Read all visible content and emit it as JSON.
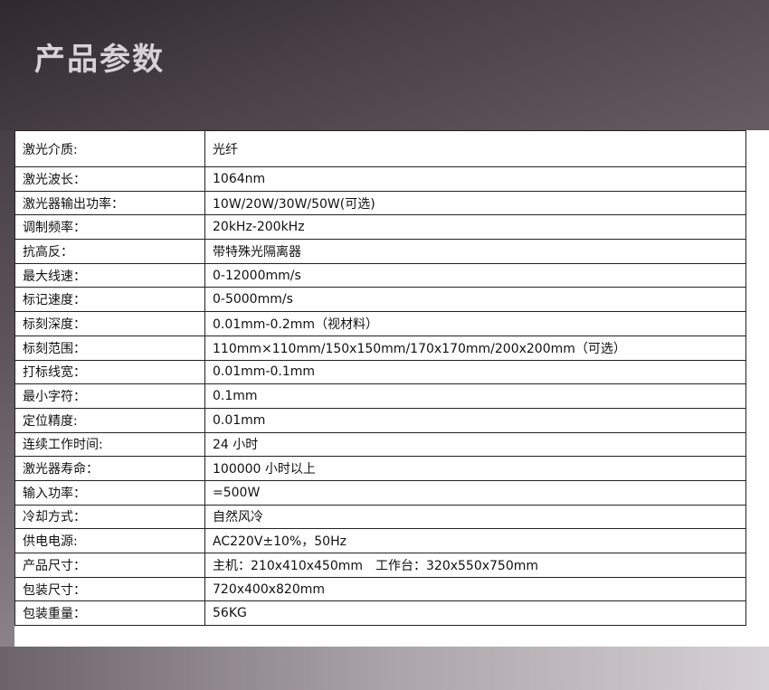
{
  "header": {
    "title": "产品参数"
  },
  "spec_rows": [
    {
      "label": "激光介质:",
      "value": "光纤"
    },
    {
      "label": "激光波长：",
      "value": "1064nm"
    },
    {
      "label": "激光器输出功率：",
      "value": "10W/20W/30W/50W(可选)"
    },
    {
      "label": "调制频率：",
      "value": "20kHz-200kHz"
    },
    {
      "label": "抗高反：",
      "value": "带特殊光隔离器"
    },
    {
      "label": "最大线速：",
      "value": "0-12000mm/s"
    },
    {
      "label": "标记速度：",
      "value": "0-5000mm/s"
    },
    {
      "label": "标刻深度：",
      "value": "0.01mm-0.2mm（视材料）"
    },
    {
      "label": "标刻范围：",
      "value": "110mm×110mm/150x150mm/170x170mm/200x200mm（可选）"
    },
    {
      "label": "打标线宽：",
      "value": "0.01mm-0.1mm"
    },
    {
      "label": "最小字符：",
      "value": "0.1mm"
    },
    {
      "label": "定位精度:",
      "value": "0.01mm"
    },
    {
      "label": "连续工作时间:",
      "value": "24 小时"
    },
    {
      "label": "激光器寿命：",
      "value": "100000 小时以上"
    },
    {
      "label": "输入功率：",
      "value": "=500W"
    },
    {
      "label": "冷却方式：",
      "value": "自然风冷"
    },
    {
      "label": "供电电源:",
      "value": "AC220V±10%，50Hz"
    },
    {
      "label": "产品尺寸：",
      "value": "主机：210x410x450mm　工作台：320x550x750mm"
    },
    {
      "label": "包装尺寸：",
      "value": "720x400x820mm"
    },
    {
      "label": "包装重量：",
      "value": "56KG"
    }
  ]
}
